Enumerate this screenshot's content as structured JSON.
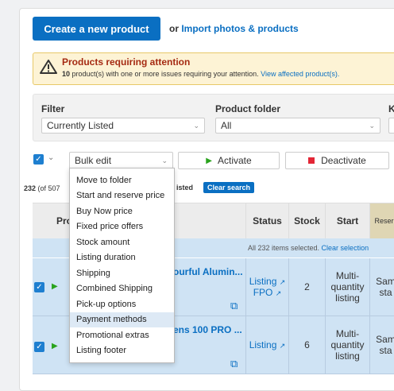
{
  "header": {
    "create_button": "Create a new product",
    "or_text": "or",
    "import_link": "Import photos & products"
  },
  "alert": {
    "title": "Products requiring attention",
    "count": "10",
    "desc": " product(s) with one or more issues requiring your attention. ",
    "link": "View affected product(s)."
  },
  "filter": {
    "filter_label": "Filter",
    "filter_value": "Currently Listed",
    "folder_label": "Product folder",
    "folder_value": "All",
    "third_label": "K",
    "third_value": "("
  },
  "toolbar": {
    "bulk_edit_label": "Bulk edit",
    "activate_label": "Activate",
    "deactivate_label": "Deactivate"
  },
  "results": {
    "count": "232",
    "of_text": "(of 507",
    "listed_text": "isted",
    "clear_search": "Clear search"
  },
  "table": {
    "headers": [
      "Pro",
      "Status",
      "Stock",
      "Start",
      "Reser"
    ],
    "selection_text": "All 232 items selected. ",
    "clear_selection": "Clear selection",
    "rows": [
      {
        "title": "ourful Alumin...",
        "status1": "Listing",
        "status2": "FPO",
        "stock": "2",
        "start": "Multi-quantity listing",
        "reserve": "Sam sta"
      },
      {
        "title": "ens 100 PRO ...",
        "status1": "Listing",
        "status2": "",
        "stock": "6",
        "start": "Multi-quantity listing",
        "reserve": "Sam sta"
      }
    ]
  },
  "bulk_menu": {
    "items": [
      "Move to folder",
      "Start and reserve price",
      "Buy Now price",
      "Fixed price offers",
      "Stock amount",
      "Listing duration",
      "Shipping",
      "Combined Shipping",
      "Pick-up options",
      "Payment methods",
      "Promotional extras",
      "Listing footer"
    ],
    "highlighted": "Payment methods"
  }
}
